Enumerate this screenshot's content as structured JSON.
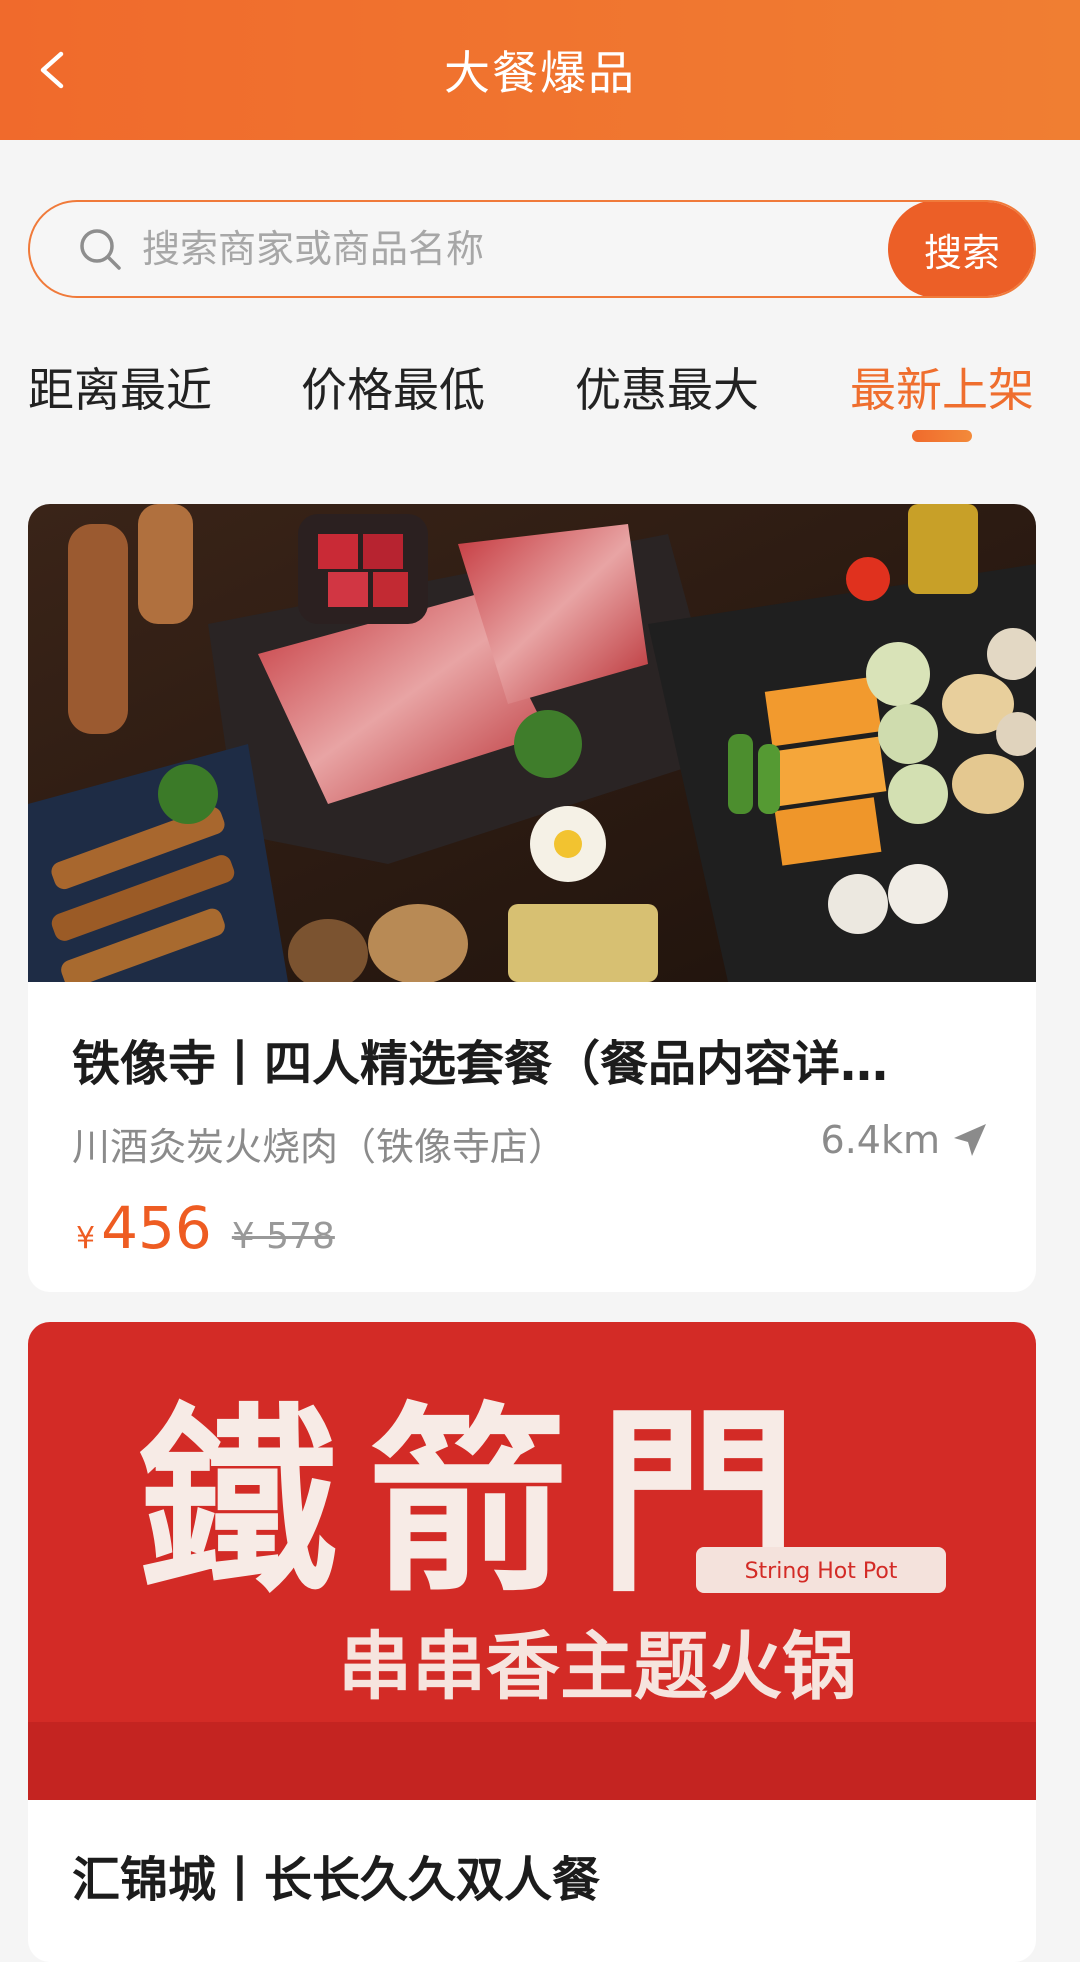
{
  "header": {
    "title": "大餐爆品",
    "back_icon": "chevron-left-icon"
  },
  "search": {
    "placeholder": "搜索商家或商品名称",
    "value": "",
    "button_label": "搜索",
    "icon": "search-icon"
  },
  "sort_tabs": [
    {
      "label": "距离最近",
      "active": false
    },
    {
      "label": "价格最低",
      "active": false
    },
    {
      "label": "优惠最大",
      "active": false
    },
    {
      "label": "最新上架",
      "active": true
    }
  ],
  "products": [
    {
      "title": "铁像寺丨四人精选套餐（餐品内容详…",
      "shop": "川酒灸炭火烧肉（铁像寺店）",
      "distance": "6.4km",
      "price_symbol": "¥",
      "price": "456",
      "original_price": "¥ 578",
      "image": "bbq-platter-photo"
    },
    {
      "title": "汇锦城丨长长久久双人餐",
      "image": "tiejianmen-logo-banner",
      "logo_text": "鐵箭門",
      "logo_subtitle": "串串香主题火锅",
      "logo_tag": "String Hot Pot"
    }
  ],
  "colors": {
    "accent": "#ef6e2e",
    "header_bg": "#f07432",
    "price": "#ee5c22",
    "banner_red": "#d32b26"
  }
}
